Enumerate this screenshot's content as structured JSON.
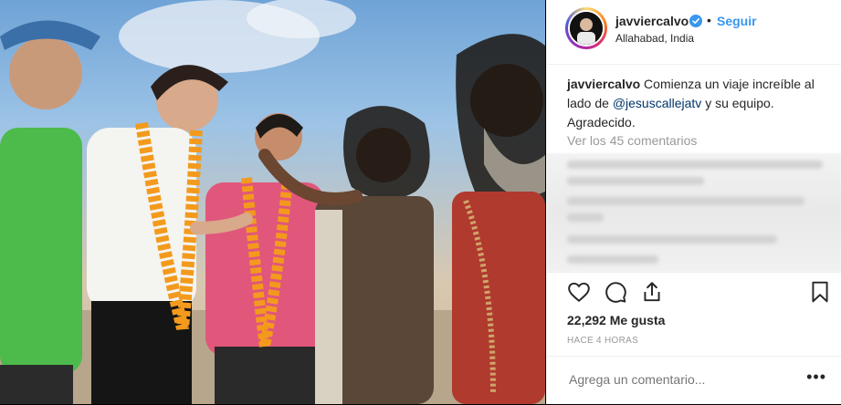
{
  "post": {
    "username": "javviercalvo",
    "follow_label": "Seguir",
    "separator": "•",
    "location": "Allahabad, India",
    "caption_user": "javviercalvo",
    "caption_text_1": " Comienza un viaje increíble al lado de ",
    "caption_mention": "@jesuscallejatv",
    "caption_text_2": " y su equipo. Agradecido.",
    "view_comments": "Ver los 45 comentarios",
    "likes": "22,292 Me gusta",
    "time": "HACE 4 HORAS",
    "comment_placeholder": "Agrega un comentario...",
    "more_label": "•••"
  },
  "colors": {
    "link": "#3897f0",
    "text": "#262626",
    "muted": "#999999",
    "verified": "#3897f0"
  },
  "icons": {
    "verified": "verified-badge-icon",
    "like": "heart-icon",
    "comment": "comment-bubble-icon",
    "share": "share-icon",
    "save": "bookmark-icon",
    "more": "ellipsis-icon"
  }
}
